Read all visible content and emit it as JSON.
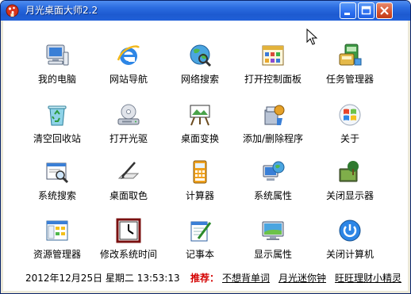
{
  "window": {
    "title": "月光桌面大师2.2"
  },
  "items": [
    {
      "label": "我的电脑",
      "icon": "my-computer-icon"
    },
    {
      "label": "网站导航",
      "icon": "internet-explorer-icon"
    },
    {
      "label": "网络搜索",
      "icon": "network-search-icon"
    },
    {
      "label": "打开控制面板",
      "icon": "control-panel-icon"
    },
    {
      "label": "任务管理器",
      "icon": "task-manager-icon"
    },
    {
      "label": "清空回收站",
      "icon": "recycle-bin-icon"
    },
    {
      "label": "打开光驱",
      "icon": "cd-drive-icon"
    },
    {
      "label": "桌面变换",
      "icon": "desktop-change-icon"
    },
    {
      "label": "添加/删除程序",
      "icon": "add-remove-programs-icon"
    },
    {
      "label": "关于",
      "icon": "windows-logo-icon"
    },
    {
      "label": "系统搜索",
      "icon": "system-search-icon"
    },
    {
      "label": "桌面取色",
      "icon": "color-picker-icon"
    },
    {
      "label": "计算器",
      "icon": "calculator-icon"
    },
    {
      "label": "系统属性",
      "icon": "system-properties-icon"
    },
    {
      "label": "关闭显示器",
      "icon": "monitor-off-icon"
    },
    {
      "label": "资源管理器",
      "icon": "explorer-icon"
    },
    {
      "label": "修改系统时间",
      "icon": "clock-icon"
    },
    {
      "label": "记事本",
      "icon": "notepad-icon"
    },
    {
      "label": "显示属性",
      "icon": "display-properties-icon"
    },
    {
      "label": "关闭计算机",
      "icon": "power-icon"
    }
  ],
  "status": {
    "datetime": "2012年12月25日  星期二  13:53:13",
    "recommend_label": "推荐：",
    "links": [
      "不想背单词",
      "月光迷你钟",
      "旺旺理财小精灵"
    ]
  },
  "colors": {
    "titlebar": "#2b6ce0",
    "recommend": "#d40000"
  }
}
